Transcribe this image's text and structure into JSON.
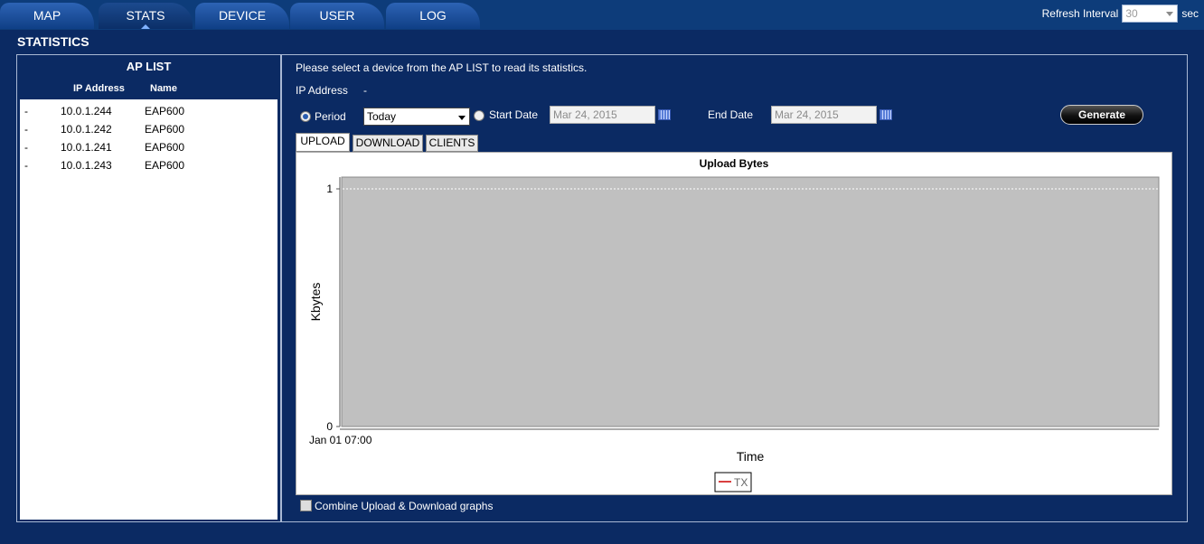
{
  "nav": {
    "tabs": [
      {
        "label": "MAP",
        "active": false
      },
      {
        "label": "STATS",
        "active": true
      },
      {
        "label": "DEVICE",
        "active": false
      },
      {
        "label": "USER",
        "active": false
      },
      {
        "label": "LOG",
        "active": false
      }
    ],
    "refresh_label": "Refresh Interval",
    "refresh_value": "30",
    "refresh_unit": "sec"
  },
  "page_title": "STATISTICS",
  "ap_list": {
    "title": "AP LIST",
    "col_ip": "IP Address",
    "col_name": "Name",
    "rows": [
      {
        "status": "-",
        "ip": "10.0.1.244",
        "name": "EAP600"
      },
      {
        "status": "-",
        "ip": "10.0.1.242",
        "name": "EAP600"
      },
      {
        "status": "-",
        "ip": "10.0.1.241",
        "name": "EAP600"
      },
      {
        "status": "-",
        "ip": "10.0.1.243",
        "name": "EAP600"
      }
    ]
  },
  "stats": {
    "instruction": "Please select a device from the AP LIST to read its statistics.",
    "ip_label": "IP Address",
    "ip_value": "-",
    "period_label": "Period",
    "period_value": "Today",
    "start_label": "Start Date",
    "start_value": "Mar 24, 2015",
    "end_label": "End Date",
    "end_value": "Mar 24, 2015",
    "generate_label": "Generate",
    "tabs": [
      "UPLOAD",
      "DOWNLOAD",
      "CLIENTS"
    ],
    "combine_label": "Combine Upload & Download graphs"
  },
  "chart_data": {
    "type": "line",
    "title": "Upload Bytes",
    "xlabel": "Time",
    "ylabel": "Kbytes",
    "x_ticks": [
      "Jan 01 07:00"
    ],
    "y_ticks": [
      0,
      1
    ],
    "ylim": [
      0,
      1
    ],
    "series": [
      {
        "name": "TX",
        "color": "#cc0000",
        "values": []
      }
    ],
    "plot_background": "#c0c0c0"
  }
}
